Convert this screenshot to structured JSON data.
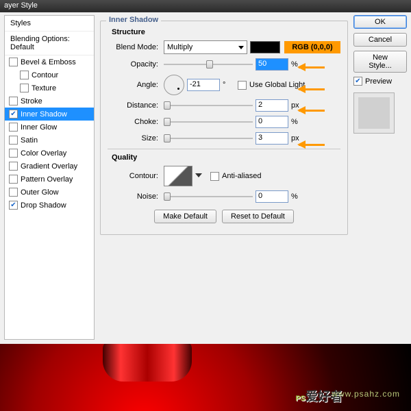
{
  "title": "ayer Style",
  "sidebar": {
    "header": "Styles",
    "blending": "Blending Options: Default",
    "items": [
      {
        "label": "Bevel & Emboss",
        "checked": false,
        "sel": false,
        "ind": 0
      },
      {
        "label": "Contour",
        "checked": false,
        "sel": false,
        "ind": 1
      },
      {
        "label": "Texture",
        "checked": false,
        "sel": false,
        "ind": 1
      },
      {
        "label": "Stroke",
        "checked": false,
        "sel": false,
        "ind": 0
      },
      {
        "label": "Inner Shadow",
        "checked": true,
        "sel": true,
        "ind": 0
      },
      {
        "label": "Inner Glow",
        "checked": false,
        "sel": false,
        "ind": 0
      },
      {
        "label": "Satin",
        "checked": false,
        "sel": false,
        "ind": 0
      },
      {
        "label": "Color Overlay",
        "checked": false,
        "sel": false,
        "ind": 0
      },
      {
        "label": "Gradient Overlay",
        "checked": false,
        "sel": false,
        "ind": 0
      },
      {
        "label": "Pattern Overlay",
        "checked": false,
        "sel": false,
        "ind": 0
      },
      {
        "label": "Outer Glow",
        "checked": false,
        "sel": false,
        "ind": 0
      },
      {
        "label": "Drop Shadow",
        "checked": true,
        "sel": false,
        "ind": 0
      }
    ]
  },
  "panel": {
    "title": "Inner Shadow",
    "structure": "Structure",
    "blendmode_lbl": "Blend Mode:",
    "blendmode_val": "Multiply",
    "rgb": "RGB (0,0,0)",
    "opacity_lbl": "Opacity:",
    "opacity_val": "50",
    "pct": "%",
    "angle_lbl": "Angle:",
    "angle_val": "-21",
    "deg": "°",
    "ugl": "Use Global Light",
    "distance_lbl": "Distance:",
    "distance_val": "2",
    "px": "px",
    "choke_lbl": "Choke:",
    "choke_val": "0",
    "size_lbl": "Size:",
    "size_val": "3",
    "quality": "Quality",
    "contour_lbl": "Contour:",
    "aa": "Anti-aliased",
    "noise_lbl": "Noise:",
    "noise_val": "0",
    "make_default": "Make Default",
    "reset_default": "Reset to Default"
  },
  "buttons": {
    "ok": "OK",
    "cancel": "Cancel",
    "newstyle": "New Style...",
    "preview": "Preview"
  },
  "wm": {
    "logo": "PS",
    "sub": "爱好者",
    "url": "www.psahz.com"
  }
}
